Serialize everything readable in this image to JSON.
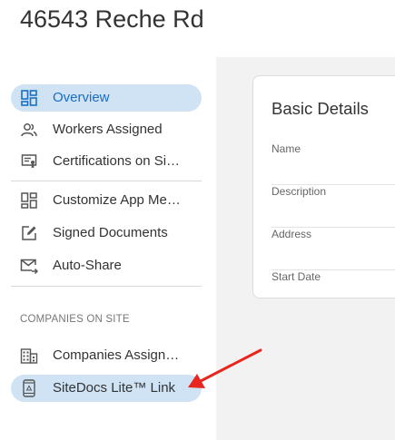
{
  "header": {
    "title": "46543 Reche Rd"
  },
  "sidebar": {
    "items": [
      {
        "label": "Overview",
        "icon": "dashboard-icon",
        "active": true
      },
      {
        "label": "Workers Assigned",
        "icon": "people-icon"
      },
      {
        "label": "Certifications on Si…",
        "icon": "certificate-icon"
      },
      {
        "label": "Customize App Me…",
        "icon": "customize-grid-icon"
      },
      {
        "label": "Signed Documents",
        "icon": "edit-document-icon"
      },
      {
        "label": "Auto-Share",
        "icon": "mail-forward-icon"
      },
      {
        "label": "Companies Assign…",
        "icon": "building-icon"
      },
      {
        "label": "SiteDocs Lite™ Link",
        "icon": "mobile-phone-icon",
        "active": true
      }
    ],
    "section_heading": "COMPANIES ON SITE"
  },
  "details": {
    "title": "Basic Details",
    "fields": [
      {
        "label": "Name"
      },
      {
        "label": "Description"
      },
      {
        "label": "Address"
      },
      {
        "label": "Start Date"
      }
    ]
  },
  "colors": {
    "active_bg": "#cfe3f5",
    "active_text": "#1b6ec2",
    "arrow": "#e8251f",
    "main_bg": "#f2f2f2"
  }
}
